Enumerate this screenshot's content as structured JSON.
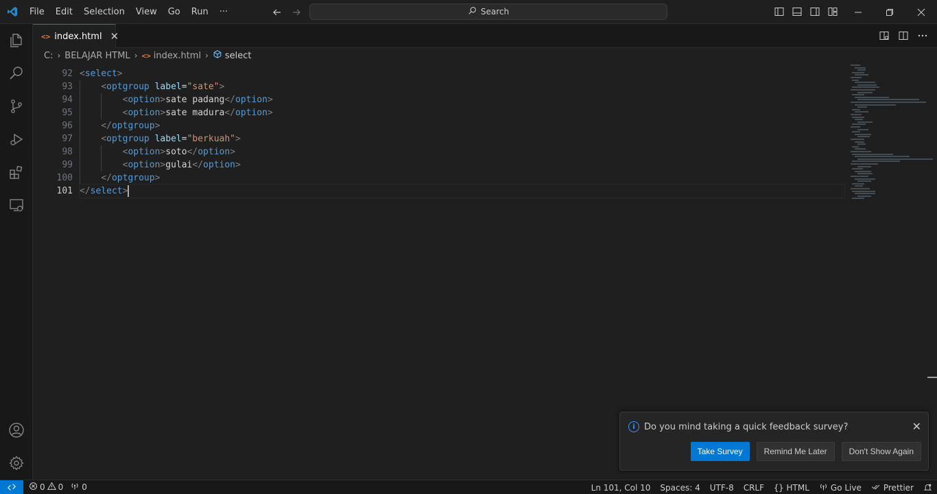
{
  "titlebar": {
    "menu": [
      "File",
      "Edit",
      "Selection",
      "View",
      "Go",
      "Run",
      "···"
    ],
    "search_placeholder": "Search"
  },
  "tab": {
    "label": "index.html",
    "icon": "<>"
  },
  "breadcrumb": [
    "C:",
    "BELAJAR HTML",
    "index.html",
    "select"
  ],
  "editor": {
    "line_numbers": [
      "92",
      "93",
      "94",
      "95",
      "96",
      "97",
      "98",
      "99",
      "100",
      "101"
    ],
    "active_line": "101"
  },
  "notification": {
    "message": "Do you mind taking a quick feedback survey?",
    "buttons": [
      "Take Survey",
      "Remind Me Later",
      "Don't Show Again"
    ]
  },
  "statusbar": {
    "errors": "0",
    "warnings": "0",
    "ports": "0",
    "position": "Ln 101, Col 10",
    "spaces": "Spaces: 4",
    "encoding": "UTF-8",
    "eol": "CRLF",
    "language": "HTML",
    "golive": "Go Live",
    "prettier": "Prettier"
  },
  "colors": {
    "accent": "#0078d4",
    "tag": "#569cd6",
    "attr": "#9cdcfe",
    "string": "#ce9178"
  }
}
